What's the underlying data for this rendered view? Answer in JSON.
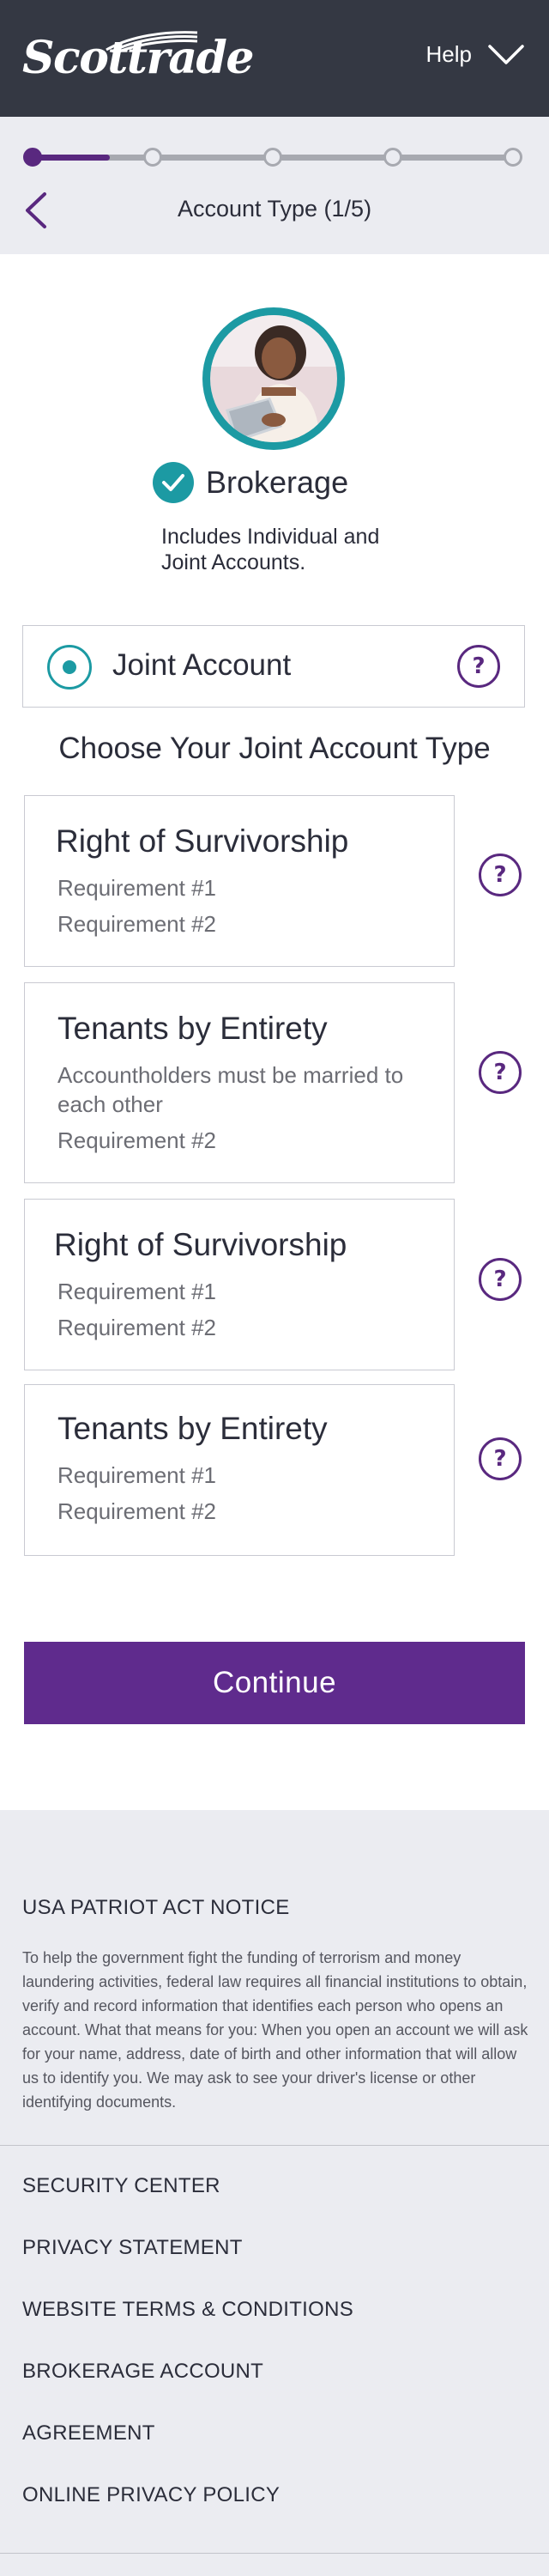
{
  "header": {
    "brand": "Scottrade",
    "help_label": "Help"
  },
  "progress": {
    "total_steps": 5,
    "current_step": 1,
    "title": "Account Type (1/5)"
  },
  "product": {
    "name": "Brokerage",
    "description": "Includes Individual and Joint Accounts."
  },
  "joint": {
    "label": "Joint Account",
    "selected": true
  },
  "choose_heading": "Choose Your Joint Account Type",
  "options": [
    {
      "title": "Right of Survivorship",
      "req1": "Requirement #1",
      "req2": "Requirement #2"
    },
    {
      "title": "Tenants by Entirety",
      "req1": "Accountholders must be married to each other",
      "req2": "Requirement #2"
    },
    {
      "title": "Right of Survivorship",
      "req1": "Requirement #1",
      "req2": "Requirement #2"
    },
    {
      "title": "Tenants by Entirety",
      "req1": "Requirement #1",
      "req2": "Requirement #2"
    }
  ],
  "help_glyph": "?",
  "continue_label": "Continue",
  "footer": {
    "notice_title": "USA PATRIOT ACT NOTICE",
    "notice_body": "To help the government fight the funding of terrorism and money laundering activities, federal law requires all financial institutions to obtain, verify and record information that identifies each person who opens an account. What that means for you: When you open an account we will ask for your name, address, date of birth and other information that will allow us to identify you. We may ask to see your driver's license or other identifying documents.",
    "links": [
      "SECURITY CENTER",
      "PRIVACY STATEMENT",
      "WEBSITE TERMS & CONDITIONS",
      "BROKERAGE ACCOUNT",
      "AGREEMENT",
      "ONLINE PRIVACY POLICY"
    ]
  },
  "colors": {
    "header_bg": "#343843",
    "accent_purple": "#5f2b8d",
    "accent_teal": "#1c9aa3",
    "surface_gray": "#ebecf1"
  },
  "icons": {
    "back": "chevron-left-icon",
    "help_menu": "chevron-down-icon",
    "check": "check-icon",
    "help": "question-icon"
  }
}
